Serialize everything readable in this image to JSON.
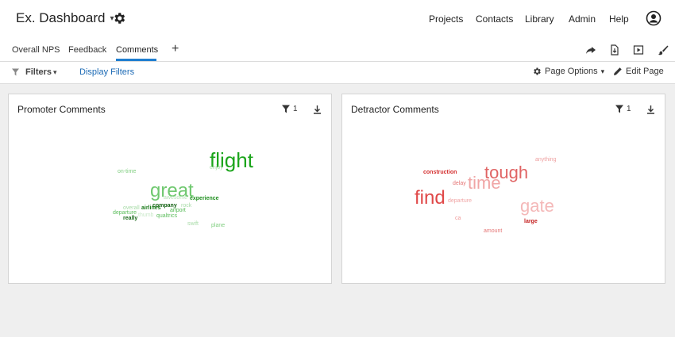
{
  "header": {
    "dashboard_title": "Ex. Dashboard",
    "nav": [
      "Projects",
      "Contacts",
      "Library",
      "Admin",
      "Help"
    ]
  },
  "tabs": {
    "items": [
      "Overall NPS",
      "Feedback",
      "Comments"
    ],
    "active": "Comments",
    "add_label": "+"
  },
  "filterbar": {
    "filters_label": "Filters",
    "display_filters": "Display Filters",
    "page_options": "Page Options",
    "edit_page": "Edit Page"
  },
  "promoter": {
    "title": "Promoter Comments",
    "filter_count": "1",
    "words": [
      {
        "text": "flight",
        "color": "#1ca51c"
      },
      {
        "text": "great",
        "color": "#6fc86f"
      },
      {
        "text": "enjoy",
        "color": "#a7dba7"
      },
      {
        "text": "on-time",
        "color": "#7fce7f"
      },
      {
        "text": "awesome",
        "color": "#b7e2b7"
      },
      {
        "text": "experience",
        "color": "#1f8f1f"
      },
      {
        "text": "company",
        "color": "#0f5f0f"
      },
      {
        "text": "rock",
        "color": "#a7dba7"
      },
      {
        "text": "overall",
        "color": "#a7dba7"
      },
      {
        "text": "airlines",
        "color": "#1a7a1a"
      },
      {
        "text": "airport",
        "color": "#4fb84f"
      },
      {
        "text": "departure",
        "color": "#5cbd5c"
      },
      {
        "text": "thumb",
        "color": "#c9e9c9"
      },
      {
        "text": "qualtrics",
        "color": "#5cbd5c"
      },
      {
        "text": "really",
        "color": "#1a6a1a"
      },
      {
        "text": "swift",
        "color": "#a7dba7"
      },
      {
        "text": "plane",
        "color": "#7fce7f"
      }
    ]
  },
  "detractor": {
    "title": "Detractor Comments",
    "filter_count": "1",
    "words": [
      {
        "text": "tough",
        "color": "#e06464"
      },
      {
        "text": "anything",
        "color": "#eea0a0"
      },
      {
        "text": "construction",
        "color": "#d42f2f"
      },
      {
        "text": "time",
        "color": "#f0a5a5"
      },
      {
        "text": "delay",
        "color": "#e57575"
      },
      {
        "text": "find",
        "color": "#e04848"
      },
      {
        "text": "departure",
        "color": "#f0a5a5"
      },
      {
        "text": "gate",
        "color": "#f4b8b8"
      },
      {
        "text": "ca",
        "color": "#ef9a9a"
      },
      {
        "text": "large",
        "color": "#c41f1f"
      },
      {
        "text": "amount",
        "color": "#e57575"
      }
    ]
  }
}
